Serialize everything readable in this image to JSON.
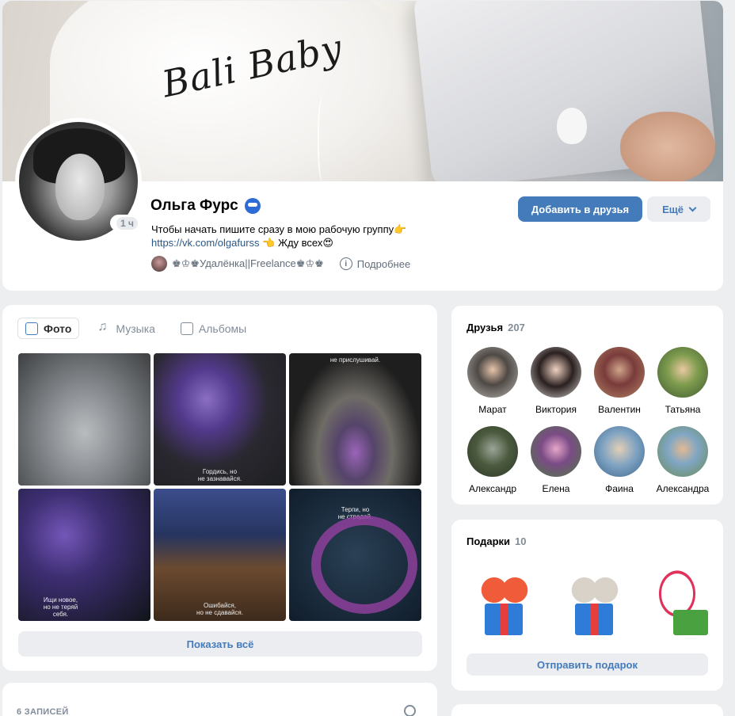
{
  "profile": {
    "name": "Ольга Фурс",
    "online": "1 ч",
    "status_text": "Чтобы начать пишите сразу в мою рабочую группу👉",
    "status_link": "https://vk.com/olgafurss",
    "status_tail": " 👈 Жду всех😍",
    "job": "♚♔♚Удалёнка||Freelance♚♔♚",
    "details_label": "Подробнее",
    "add_friend_label": "Добавить в друзья",
    "more_label": "Ещё",
    "cover_text": "Bali Baby"
  },
  "media": {
    "tabs": [
      {
        "label": "Фото",
        "icon": "photo-icon"
      },
      {
        "label": "Музыка",
        "icon": "music-icon"
      },
      {
        "label": "Альбомы",
        "icon": "albums-icon"
      }
    ],
    "photo_captions": [
      "",
      "Гордись, но\nне зазнавайся.",
      "не прислушивай.",
      "Ищи новое,\nно не теряй\nсебя.",
      "Ошибайся,\nно не сдавайся.",
      "Терпи, но\nне страдай."
    ],
    "show_all_label": "Показать всё"
  },
  "posts": {
    "count_label": "6 ЗАПИСЕЙ"
  },
  "friends": {
    "title": "Друзья",
    "count": "207",
    "items": [
      "Марат",
      "Виктория",
      "Валентин",
      "Татьяна",
      "Александр",
      "Елена",
      "Фаина",
      "Александра"
    ]
  },
  "gifts": {
    "title": "Подарки",
    "count": "10",
    "send_label": "Отправить подарок"
  },
  "colors": {
    "accent": "#447bba",
    "link": "#2a5885",
    "page_bg": "#edeef0",
    "secondary_text": "#818c99"
  }
}
